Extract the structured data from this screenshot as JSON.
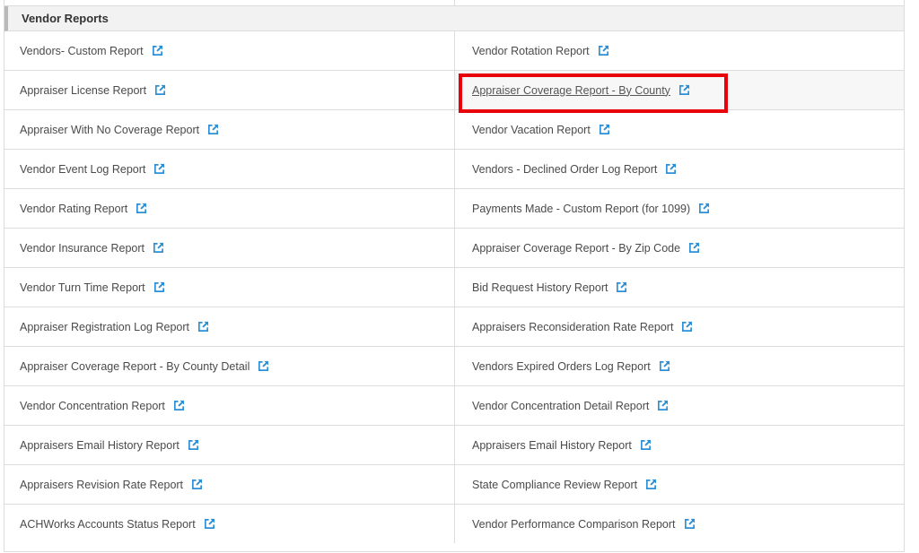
{
  "section": {
    "title": "Vendor Reports"
  },
  "colors": {
    "link_icon": "#2d8fd6",
    "highlight_border": "#e8000b"
  },
  "icons": {
    "report_link": "external-link-icon"
  },
  "rows": [
    {
      "left": "Vendors- Custom Report",
      "right": "Vendor Rotation Report"
    },
    {
      "left": "Appraiser License Report",
      "right": "Appraiser Coverage Report - By County"
    },
    {
      "left": "Appraiser With No Coverage Report",
      "right": "Vendor Vacation Report"
    },
    {
      "left": "Vendor Event Log Report",
      "right": "Vendors - Declined Order Log Report"
    },
    {
      "left": "Vendor Rating Report",
      "right": "Payments Made - Custom Report (for 1099)"
    },
    {
      "left": "Vendor Insurance Report",
      "right": "Appraiser Coverage Report - By Zip Code"
    },
    {
      "left": "Vendor Turn Time Report",
      "right": "Bid Request History Report"
    },
    {
      "left": "Appraiser Registration Log Report",
      "right": "Appraisers Reconsideration Rate Report"
    },
    {
      "left": "Appraiser Coverage Report - By County Detail",
      "right": "Vendors Expired Orders Log Report"
    },
    {
      "left": "Vendor Concentration Report",
      "right": "Vendor Concentration Detail Report"
    },
    {
      "left": "Appraisers Email History Report",
      "right": "Appraisers Email History Report"
    },
    {
      "left": "Appraisers Revision Rate Report",
      "right": "State Compliance Review Report"
    },
    {
      "left": "ACHWorks Accounts Status Report",
      "right": "Vendor Performance Comparison Report"
    }
  ]
}
